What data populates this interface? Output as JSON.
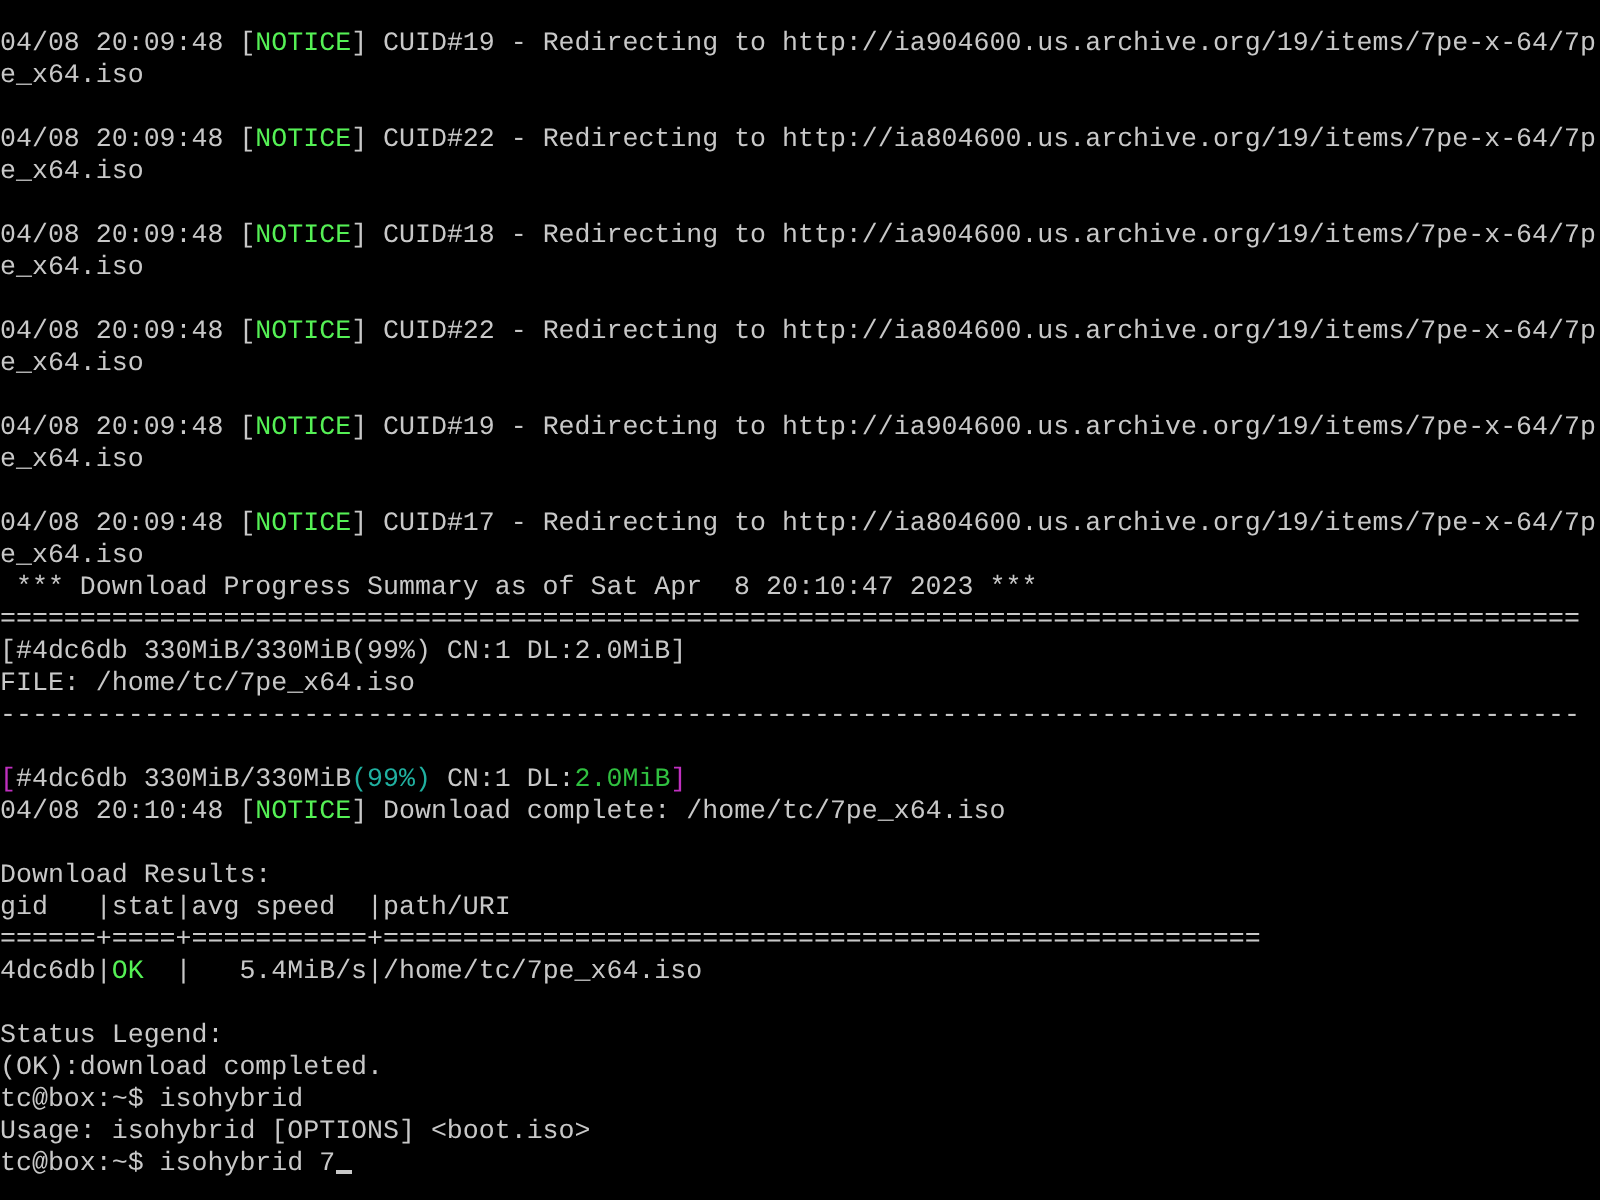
{
  "terminal": {
    "lines": [
      {
        "kind": "text",
        "segments": [
          {
            "text": "04/08 20:09:48 ["
          },
          {
            "text": "NOTICE",
            "color": "#55f055"
          },
          {
            "text": "] CUID#19 - Redirecting to http://ia904600.us.archive.org/19/items/7pe-x-64/7pe_x64.iso"
          }
        ]
      },
      {
        "kind": "blank"
      },
      {
        "kind": "text",
        "segments": [
          {
            "text": "04/08 20:09:48 ["
          },
          {
            "text": "NOTICE",
            "color": "#55f055"
          },
          {
            "text": "] CUID#22 - Redirecting to http://ia804600.us.archive.org/19/items/7pe-x-64/7pe_x64.iso"
          }
        ]
      },
      {
        "kind": "blank"
      },
      {
        "kind": "text",
        "segments": [
          {
            "text": "04/08 20:09:48 ["
          },
          {
            "text": "NOTICE",
            "color": "#55f055"
          },
          {
            "text": "] CUID#18 - Redirecting to http://ia904600.us.archive.org/19/items/7pe-x-64/7pe_x64.iso"
          }
        ]
      },
      {
        "kind": "blank"
      },
      {
        "kind": "text",
        "segments": [
          {
            "text": "04/08 20:09:48 ["
          },
          {
            "text": "NOTICE",
            "color": "#55f055"
          },
          {
            "text": "] CUID#22 - Redirecting to http://ia804600.us.archive.org/19/items/7pe-x-64/7pe_x64.iso"
          }
        ]
      },
      {
        "kind": "blank"
      },
      {
        "kind": "text",
        "segments": [
          {
            "text": "04/08 20:09:48 ["
          },
          {
            "text": "NOTICE",
            "color": "#55f055"
          },
          {
            "text": "] CUID#19 - Redirecting to http://ia904600.us.archive.org/19/items/7pe-x-64/7pe_x64.iso"
          }
        ]
      },
      {
        "kind": "blank"
      },
      {
        "kind": "text",
        "segments": [
          {
            "text": "04/08 20:09:48 ["
          },
          {
            "text": "NOTICE",
            "color": "#55f055"
          },
          {
            "text": "] CUID#17 - Redirecting to http://ia804600.us.archive.org/19/items/7pe-x-64/7pe_x64.iso"
          }
        ]
      },
      {
        "kind": "text",
        "segments": [
          {
            "text": " *** Download Progress Summary as of Sat Apr  8 20:10:47 2023 ***"
          }
        ]
      },
      {
        "kind": "text",
        "segments": [
          {
            "text": "==================================================================================================="
          }
        ]
      },
      {
        "kind": "text",
        "segments": [
          {
            "text": "[#4dc6db 330MiB/330MiB(99%) CN:1 DL:2.0MiB]"
          }
        ]
      },
      {
        "kind": "text",
        "segments": [
          {
            "text": "FILE: /home/tc/7pe_x64.iso"
          }
        ]
      },
      {
        "kind": "text",
        "segments": [
          {
            "text": "---------------------------------------------------------------------------------------------------"
          }
        ]
      },
      {
        "kind": "blank"
      },
      {
        "kind": "text",
        "segments": [
          {
            "text": "[",
            "color": "#c030c0"
          },
          {
            "text": "#4dc6db 330MiB/330MiB"
          },
          {
            "text": "(99%)",
            "color": "#20b0a0"
          },
          {
            "text": " CN:1 DL:"
          },
          {
            "text": "2.0MiB",
            "color": "#30c040"
          },
          {
            "text": "]",
            "color": "#c030c0"
          }
        ]
      },
      {
        "kind": "text",
        "segments": [
          {
            "text": "04/08 20:10:48 ["
          },
          {
            "text": "NOTICE",
            "color": "#55f055"
          },
          {
            "text": "] Download complete: /home/tc/7pe_x64.iso"
          }
        ]
      },
      {
        "kind": "blank"
      },
      {
        "kind": "text",
        "segments": [
          {
            "text": "Download Results:"
          }
        ]
      },
      {
        "kind": "text",
        "segments": [
          {
            "text": "gid   |stat|avg speed  |path/URI"
          }
        ]
      },
      {
        "kind": "text",
        "segments": [
          {
            "text": "======+====+===========+======================================================="
          }
        ]
      },
      {
        "kind": "text",
        "segments": [
          {
            "text": "4dc6db|"
          },
          {
            "text": "OK",
            "color": "#55f055"
          },
          {
            "text": "  |   5.4MiB/s|/home/tc/7pe_x64.iso"
          }
        ]
      },
      {
        "kind": "blank"
      },
      {
        "kind": "text",
        "segments": [
          {
            "text": "Status Legend:"
          }
        ]
      },
      {
        "kind": "text",
        "segments": [
          {
            "text": "(OK):download completed."
          }
        ]
      },
      {
        "kind": "text",
        "segments": [
          {
            "text": "tc@box:~$ isohybrid"
          }
        ]
      },
      {
        "kind": "text",
        "segments": [
          {
            "text": "Usage: isohybrid [OPTIONS] <boot.iso>"
          }
        ]
      },
      {
        "kind": "prompt",
        "segments": [
          {
            "text": "tc@box:~$ isohybrid 7"
          }
        ]
      }
    ]
  }
}
